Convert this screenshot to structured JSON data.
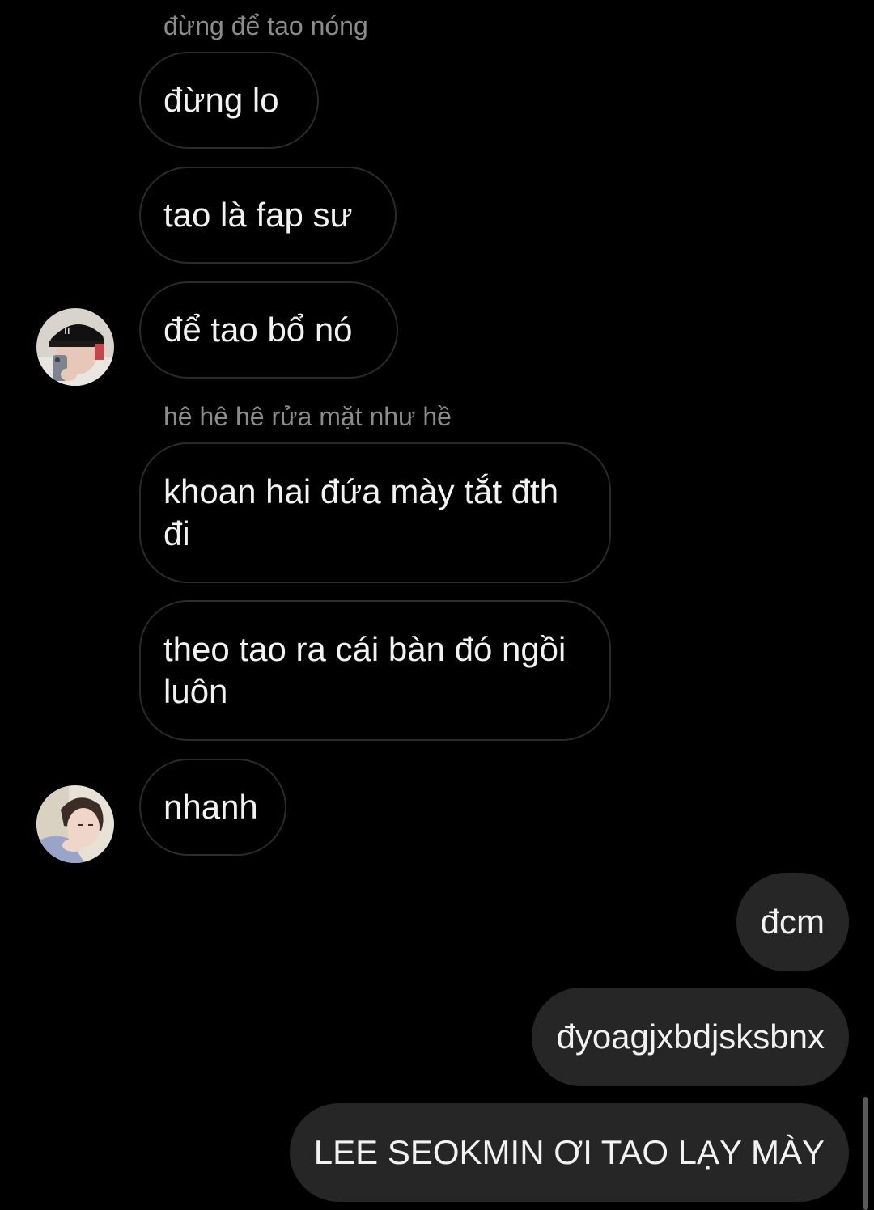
{
  "messages": {
    "sender1_name": "đừng để tao nóng",
    "m1": "đừng lo",
    "m2": "tao là fap sư",
    "m3": "để tao bổ nó",
    "sender2_name": "hê hê hê rửa mặt như hề",
    "m4": "khoan hai đứa mày tắt đth đi",
    "m5": "theo tao ra cái bàn đó ngồi luôn",
    "m6": "nhanh",
    "out1": "đcm",
    "out2": "đyoagjxbdjsksbnx",
    "out3": "LEE SEOKMIN ƠI TAO LẠY MÀY"
  },
  "colors": {
    "background": "#000000",
    "incoming_border": "#2a2a2a",
    "outgoing_fill": "#262626",
    "sender_name": "#8c8c8c",
    "text": "#f2f2f2"
  }
}
